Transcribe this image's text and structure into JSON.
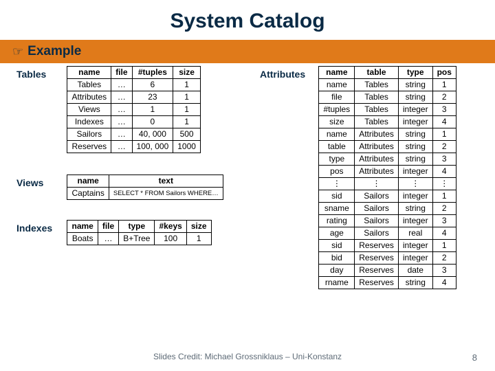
{
  "title": "System Catalog",
  "section": "Example",
  "credit": "Slides Credit: Michael Grossniklaus – Uni-Konstanz",
  "page": "8",
  "tables_block": {
    "label": "Tables",
    "headers": [
      "name",
      "file",
      "#tuples",
      "size"
    ],
    "rows": [
      [
        "Tables",
        "…",
        "6",
        "1"
      ],
      [
        "Attributes",
        "…",
        "23",
        "1"
      ],
      [
        "Views",
        "…",
        "1",
        "1"
      ],
      [
        "Indexes",
        "…",
        "0",
        "1"
      ],
      [
        "Sailors",
        "…",
        "40, 000",
        "500"
      ],
      [
        "Reserves",
        "…",
        "100, 000",
        "1000"
      ]
    ]
  },
  "views_block": {
    "label": "Views",
    "headers": [
      "name",
      "text"
    ],
    "rows": [
      [
        "Captains",
        "SELECT * FROM Sailors WHERE…"
      ]
    ]
  },
  "indexes_block": {
    "label": "Indexes",
    "headers": [
      "name",
      "file",
      "type",
      "#keys",
      "size"
    ],
    "rows": [
      [
        "Boats",
        "…",
        "B+Tree",
        "100",
        "1"
      ]
    ]
  },
  "attrs_block": {
    "label": "Attributes",
    "headers": [
      "name",
      "table",
      "type",
      "pos"
    ],
    "rows": [
      [
        "name",
        "Tables",
        "string",
        "1"
      ],
      [
        "file",
        "Tables",
        "string",
        "2"
      ],
      [
        "#tuples",
        "Tables",
        "integer",
        "3"
      ],
      [
        "size",
        "Tables",
        "integer",
        "4"
      ],
      [
        "name",
        "Attributes",
        "string",
        "1"
      ],
      [
        "table",
        "Attributes",
        "string",
        "2"
      ],
      [
        "type",
        "Attributes",
        "string",
        "3"
      ],
      [
        "pos",
        "Attributes",
        "integer",
        "4"
      ],
      [
        "⋮",
        "⋮",
        "⋮",
        "⋮"
      ],
      [
        "sid",
        "Sailors",
        "integer",
        "1"
      ],
      [
        "sname",
        "Sailors",
        "string",
        "2"
      ],
      [
        "rating",
        "Sailors",
        "integer",
        "3"
      ],
      [
        "age",
        "Sailors",
        "real",
        "4"
      ],
      [
        "sid",
        "Reserves",
        "integer",
        "1"
      ],
      [
        "bid",
        "Reserves",
        "integer",
        "2"
      ],
      [
        "day",
        "Reserves",
        "date",
        "3"
      ],
      [
        "rname",
        "Reserves",
        "string",
        "4"
      ]
    ]
  },
  "chart_data": {
    "type": "table",
    "title": "System Catalog — Example",
    "tables": [
      {
        "name": "Tables",
        "columns": [
          "name",
          "file",
          "#tuples",
          "size"
        ],
        "rows": [
          [
            "Tables",
            "…",
            6,
            1
          ],
          [
            "Attributes",
            "…",
            23,
            1
          ],
          [
            "Views",
            "…",
            1,
            1
          ],
          [
            "Indexes",
            "…",
            0,
            1
          ],
          [
            "Sailors",
            "…",
            40000,
            500
          ],
          [
            "Reserves",
            "…",
            100000,
            1000
          ]
        ]
      },
      {
        "name": "Views",
        "columns": [
          "name",
          "text"
        ],
        "rows": [
          [
            "Captains",
            "SELECT * FROM Sailors WHERE…"
          ]
        ]
      },
      {
        "name": "Indexes",
        "columns": [
          "name",
          "file",
          "type",
          "#keys",
          "size"
        ],
        "rows": [
          [
            "Boats",
            "…",
            "B+Tree",
            100,
            1
          ]
        ]
      },
      {
        "name": "Attributes",
        "columns": [
          "name",
          "table",
          "type",
          "pos"
        ],
        "rows": [
          [
            "name",
            "Tables",
            "string",
            1
          ],
          [
            "file",
            "Tables",
            "string",
            2
          ],
          [
            "#tuples",
            "Tables",
            "integer",
            3
          ],
          [
            "size",
            "Tables",
            "integer",
            4
          ],
          [
            "name",
            "Attributes",
            "string",
            1
          ],
          [
            "table",
            "Attributes",
            "string",
            2
          ],
          [
            "type",
            "Attributes",
            "string",
            3
          ],
          [
            "pos",
            "Attributes",
            "integer",
            4
          ],
          [
            "sid",
            "Sailors",
            "integer",
            1
          ],
          [
            "sname",
            "Sailors",
            "string",
            2
          ],
          [
            "rating",
            "Sailors",
            "integer",
            3
          ],
          [
            "age",
            "Sailors",
            "real",
            4
          ],
          [
            "sid",
            "Reserves",
            "integer",
            1
          ],
          [
            "bid",
            "Reserves",
            "integer",
            2
          ],
          [
            "day",
            "Reserves",
            "date",
            3
          ],
          [
            "rname",
            "Reserves",
            "string",
            4
          ]
        ]
      }
    ]
  }
}
